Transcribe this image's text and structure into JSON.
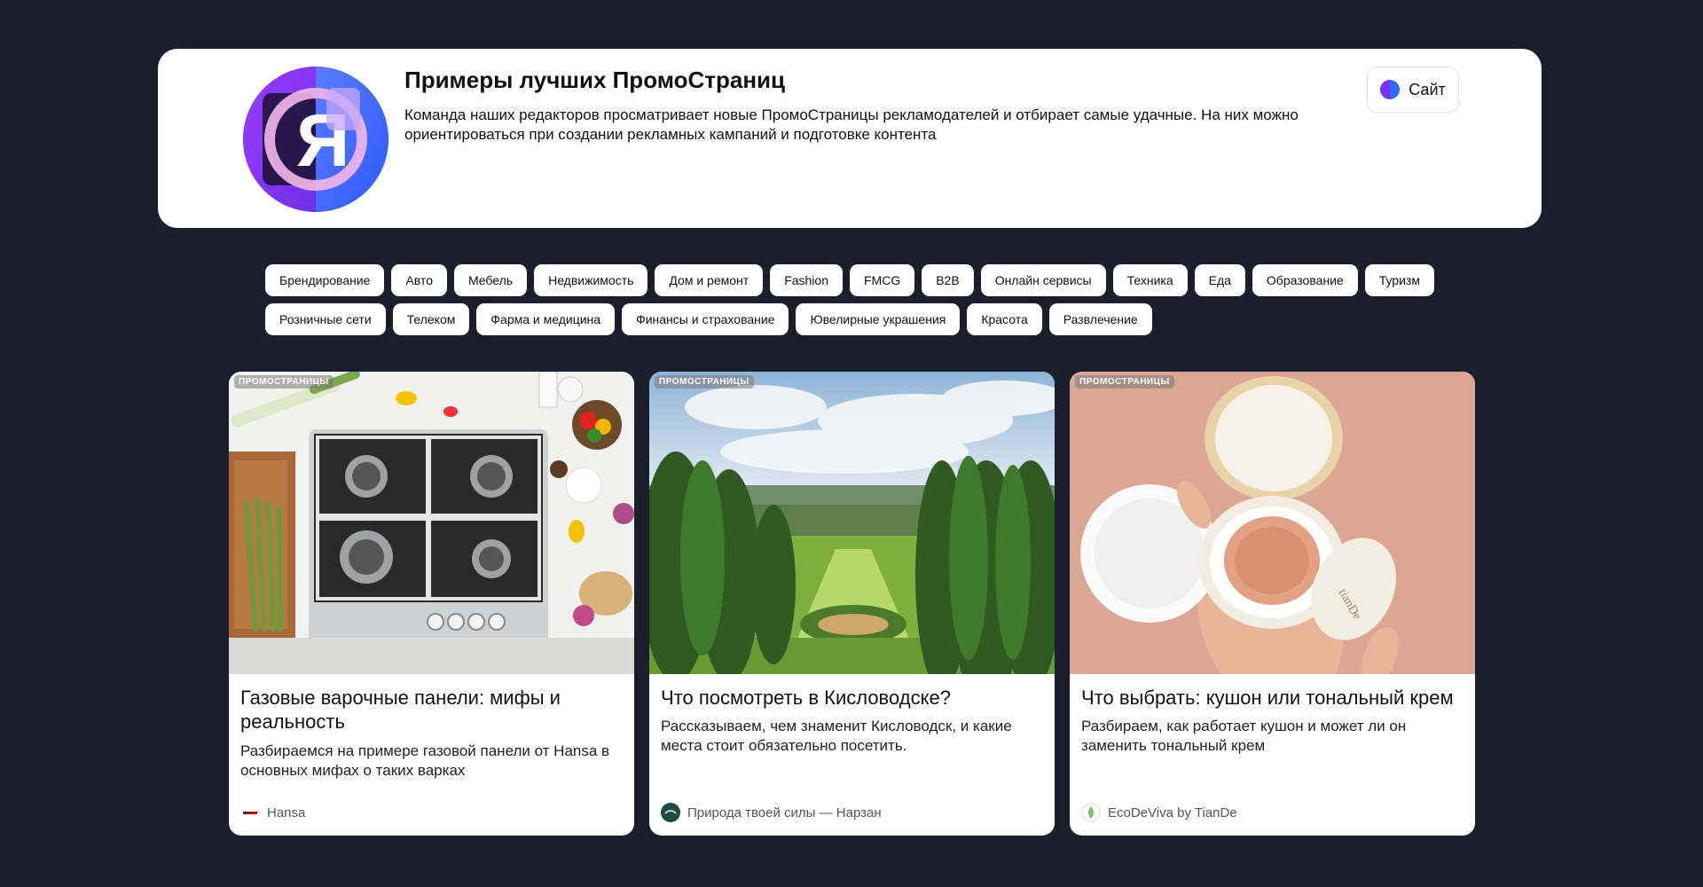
{
  "header": {
    "title": "Примеры лучших ПромоСтраниц",
    "description": "Команда наших редакторов просматривает новые ПромоСтраницы рекламодателей и отбирает самые удачные. На них можно ориентироваться при создании рекламных кампаний и подготовке контента",
    "site_button_label": "Сайт",
    "logo_icon": "yandex-ya-logo-icon"
  },
  "categories": [
    "Брендирование",
    "Авто",
    "Мебель",
    "Недвижимость",
    "Дом и ремонт",
    "Fashion",
    "FMCG",
    "B2B",
    "Онлайн сервисы",
    "Техника",
    "Еда",
    "Образование",
    "Туризм",
    "Розничные сети",
    "Телеком",
    "Фарма и медицина",
    "Финансы и страхование",
    "Ювелирные украшения",
    "Красота",
    "Развлечение"
  ],
  "cards": [
    {
      "badge": "ПРОМОСТРАНИЦЫ",
      "title": "Газовые варочные панели: мифы и реальность",
      "description": "Разбираемся на примере газовой панели от Hansa в основных мифах о таких варках",
      "source": "Hansa",
      "image": "gas-cooktop-photo"
    },
    {
      "badge": "ПРОМОСТРАНИЦЫ",
      "title": "Что посмотреть в Кисловодске?",
      "description": "Рассказываем, чем знаменит Кисловодск, и какие места стоит обязательно посетить.",
      "source": "Природа твоей силы — Нарзан",
      "image": "kislovodsk-park-photo"
    },
    {
      "badge": "ПРОМОСТРАНИЦЫ",
      "title": "Что выбрать: кушон или тональный крем",
      "description": "Разбираем, как работает кушон и может ли он заменить тональный крем",
      "source": "EcoDeViva by TianDe",
      "image": "cushion-compact-photo"
    }
  ],
  "colors": {
    "background": "#1b1f2d",
    "card": "#ffffff",
    "accent_purple": "#7b2ff7",
    "accent_blue": "#2f6bff"
  }
}
